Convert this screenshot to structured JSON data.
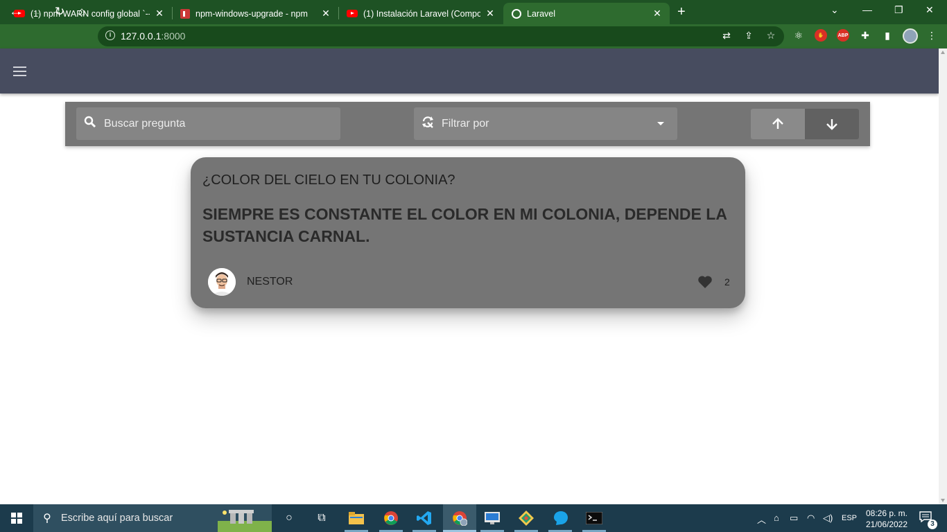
{
  "browser": {
    "tabs": [
      {
        "title": "(1) npm WARN config global `--g",
        "icon": "youtube-icon",
        "active": false
      },
      {
        "title": "npm-windows-upgrade - npm",
        "icon": "npm-icon",
        "active": false
      },
      {
        "title": "(1) Instalación Laravel (Composer",
        "icon": "youtube-icon",
        "active": false
      },
      {
        "title": "Laravel",
        "icon": "globe-icon",
        "active": true
      }
    ],
    "url_host": "127.0.0.1",
    "url_port": ":8000",
    "theme_color": "#2e6b2f"
  },
  "page": {
    "search_placeholder": "Buscar pregunta",
    "filter_placeholder": "Filtrar por",
    "card": {
      "question": "¿COLOR DEL CIELO EN TU COLONIA?",
      "answer": "SIEMPRE ES CONSTANTE EL COLOR EN MI COLONIA, DEPENDE LA SUSTANCIA CARNAL.",
      "author": "NESTOR",
      "likes": "2"
    },
    "appbar_color": "#474c5f"
  },
  "taskbar": {
    "search_placeholder": "Escribe aquí para buscar",
    "language": "ESP",
    "time": "08:26 p. m.",
    "date": "21/06/2022",
    "notification_count": "3"
  }
}
